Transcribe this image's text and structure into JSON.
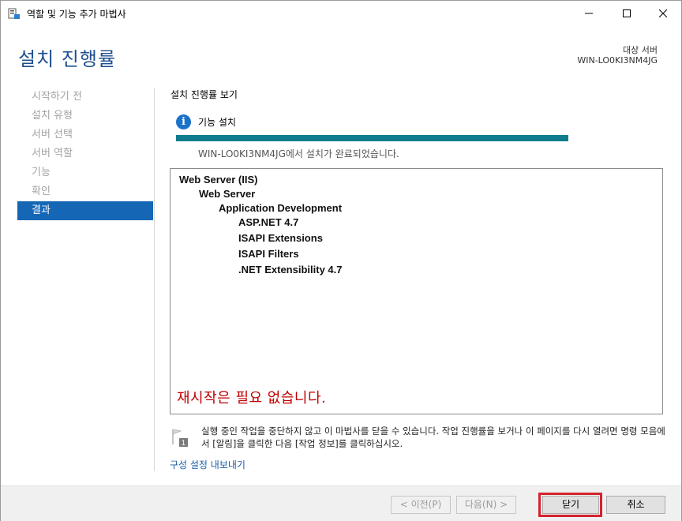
{
  "window": {
    "title": "역할 및 기능 추가 마법사",
    "controls": [
      "minimize-icon",
      "maximize-icon",
      "close-icon"
    ]
  },
  "header": {
    "page_title": "설치 진행률",
    "target_label": "대상 서버",
    "target_value": "WIN-LO0KI3NM4JG"
  },
  "nav": {
    "items": [
      {
        "label": "시작하기 전",
        "active": false
      },
      {
        "label": "설치 유형",
        "active": false
      },
      {
        "label": "서버 선택",
        "active": false
      },
      {
        "label": "서버 역할",
        "active": false
      },
      {
        "label": "기능",
        "active": false
      },
      {
        "label": "확인",
        "active": false
      },
      {
        "label": "결과",
        "active": true
      }
    ]
  },
  "main": {
    "section_title": "설치 진행률 보기",
    "status_icon": "info-icon",
    "feature_label": "기능 설치",
    "progress_percent": 100,
    "complete_message": "WIN-LO0KI3NM4JG에서 설치가 완료되었습니다.",
    "results": [
      {
        "text": "Web Server (IIS)",
        "level": 0
      },
      {
        "text": "Web Server",
        "level": 1
      },
      {
        "text": "Application Development",
        "level": 2
      },
      {
        "text": "ASP.NET 4.7",
        "level": 3
      },
      {
        "text": "ISAPI Extensions",
        "level": 3
      },
      {
        "text": "ISAPI Filters",
        "level": 3
      },
      {
        "text": ".NET Extensibility 4.7",
        "level": 3
      }
    ],
    "restart_note": "재시작은 필요 없습니다.",
    "notice_icon": "notification-flag-icon",
    "notice_text": "실행 중인 작업을 중단하지 않고 이 마법사를 닫을 수 있습니다. 작업 진행률을 보거나 이 페이지를 다시 열려면 명령 모음에서 [알림]을 클릭한 다음 [작업 정보]를 클릭하십시오.",
    "export_link": "구성 설정 내보내기"
  },
  "footer": {
    "prev_label": "< 이전(P)",
    "next_label": "다음(N) >",
    "close_label": "닫기",
    "cancel_label": "취소"
  },
  "colors": {
    "title_blue": "#1e4f8e",
    "nav_active": "#1567b6",
    "progress": "#0f7c8e",
    "restart_red": "#c00000",
    "highlight_red": "#d3242d"
  }
}
